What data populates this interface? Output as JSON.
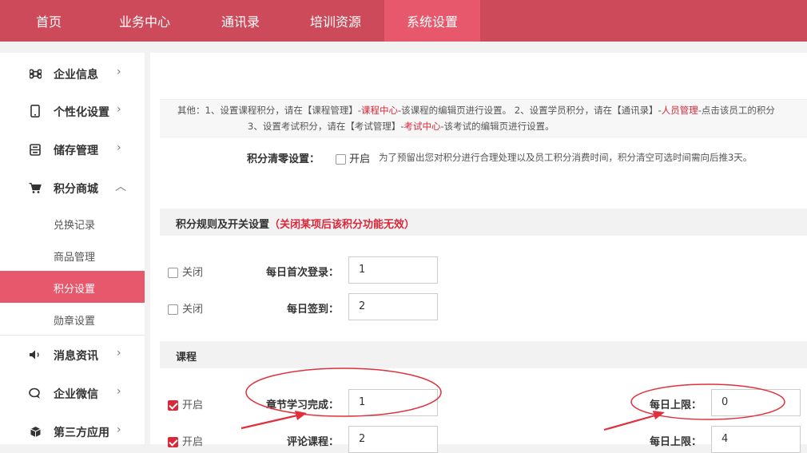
{
  "topnav": {
    "tabs": [
      {
        "label": "首页"
      },
      {
        "label": "业务中心"
      },
      {
        "label": "通讯录"
      },
      {
        "label": "培训资源"
      },
      {
        "label": "系统设置"
      }
    ]
  },
  "sidebar": {
    "items": [
      {
        "label": "企业信息",
        "icon": "command-icon"
      },
      {
        "label": "个性化设置",
        "icon": "phone-icon"
      },
      {
        "label": "储存管理",
        "icon": "storage-icon"
      },
      {
        "label": "积分商城",
        "icon": "cart-icon"
      },
      {
        "label": "消息资讯",
        "icon": "speaker-icon"
      },
      {
        "label": "企业微信",
        "icon": "chat-icon"
      },
      {
        "label": "第三方应用",
        "icon": "box-icon"
      }
    ],
    "subitems": [
      {
        "label": "兑换记录"
      },
      {
        "label": "商品管理"
      },
      {
        "label": "积分设置"
      },
      {
        "label": "勋章设置"
      }
    ],
    "chevron_right": "›",
    "chevron_up": "︿"
  },
  "note": {
    "line1_a": "其他：1、设置课程积分，请在【课程管理】-",
    "line1_link1": "课程中心",
    "line1_b": "-该课程的编辑页进行设置。    2、设置学员积分，请在【通讯录】-",
    "line1_link2": "人员管理",
    "line1_c": "-点击该员工的积分",
    "line2_a": "3、设置考试积分，请在【考试管理】-",
    "line2_link": "考试中心",
    "line2_b": "-该考试的编辑页进行设置。"
  },
  "clear": {
    "label": "积分清零设置：",
    "toggle": "开启",
    "desc": "为了预留出您对积分进行合理处理以及员工积分消费时间，积分清空可选时间需向后推3天。"
  },
  "rules": {
    "title": "积分规则及开关设置",
    "warning": "（关闭某项后该积分功能无效）",
    "rows": [
      {
        "toggle": "关闭",
        "label": "每日首次登录：",
        "value": "1"
      },
      {
        "toggle": "关闭",
        "label": "每日签到：",
        "value": "2"
      }
    ]
  },
  "course": {
    "title": "课程",
    "rows": [
      {
        "toggle": "开启",
        "label": "章节学习完成：",
        "value": "1",
        "limit_label": "每日上限：",
        "limit_value": "0"
      },
      {
        "toggle": "开启",
        "label": "评论课程：",
        "value": "2",
        "limit_label": "每日上限：",
        "limit_value": "4"
      }
    ]
  },
  "colors": {
    "brand": "#cd4a5a",
    "active": "#e8586c",
    "annotation": "#e0303c"
  }
}
